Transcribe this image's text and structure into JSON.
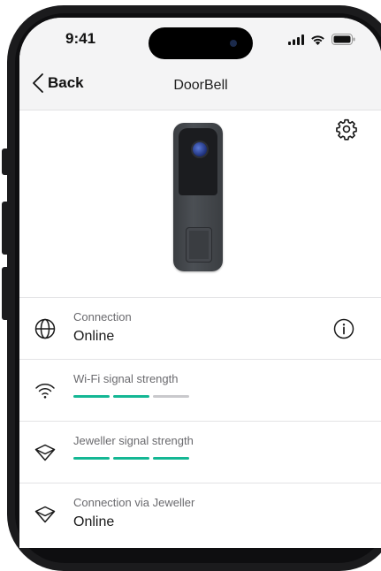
{
  "status_bar": {
    "time": "9:41",
    "icons": [
      "cellular-signal-icon",
      "wifi-icon",
      "battery-icon"
    ]
  },
  "nav": {
    "back_label": "Back",
    "title": "DoorBell"
  },
  "device": {
    "image": "doorbell-device"
  },
  "rows": [
    {
      "icon": "globe-icon",
      "label": "Connection",
      "value": "Online"
    },
    {
      "icon": "wifi-icon",
      "label": "Wi-Fi signal strength",
      "signal_level": 2,
      "signal_max": 3
    },
    {
      "icon": "jeweller-icon",
      "label": "Jeweller signal strength",
      "signal_level": 3,
      "signal_max": 3
    },
    {
      "icon": "jeweller-icon",
      "label": "Connection via Jeweller",
      "value": "Online"
    }
  ],
  "colors": {
    "signal_on": "#14b794",
    "signal_off": "#c9c9cc",
    "header_bg": "#f4f4f5"
  }
}
